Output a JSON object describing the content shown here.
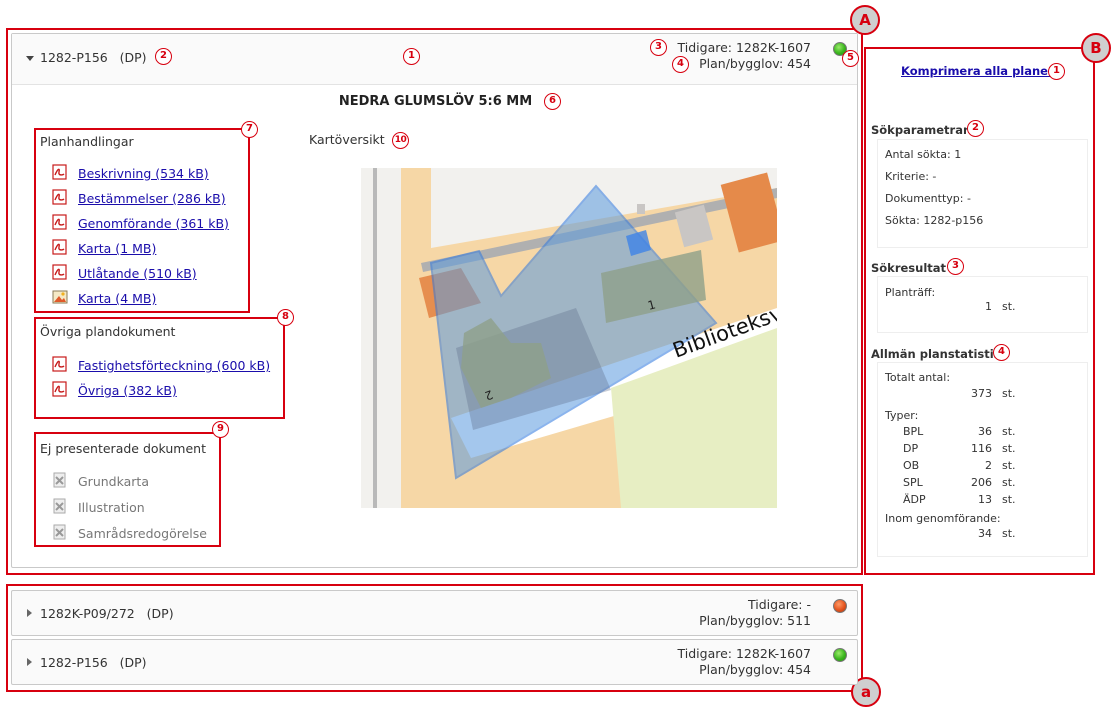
{
  "plan_main": {
    "code": "1282-P156",
    "type": "(DP)",
    "tidigare": "Tidigare: 1282K-1607",
    "plan_bygglov": "Plan/bygglov: 454",
    "status_color": "#39b51d",
    "title": "NEDRA GLUMSLÖV 5:6 MM",
    "karta_label": "Kartöversikt",
    "map_labels": {
      "parcel_1": "1",
      "parcel_2": "2",
      "street": "Biblioteksvä"
    }
  },
  "planhandlingar": {
    "title": "Planhandlingar",
    "items": [
      {
        "label": "Beskrivning (534 kB)",
        "icon": "pdf-icon"
      },
      {
        "label": "Bestämmelser (286 kB)",
        "icon": "pdf-icon"
      },
      {
        "label": "Genomförande (361 kB)",
        "icon": "pdf-icon"
      },
      {
        "label": "Karta (1 MB)",
        "icon": "pdf-icon"
      },
      {
        "label": "Utlåtande (510 kB)",
        "icon": "pdf-icon"
      },
      {
        "label": "Karta (4 MB)",
        "icon": "image-icon"
      }
    ]
  },
  "ovriga": {
    "title": "Övriga plandokument",
    "items": [
      {
        "label": "Fastighetsförteckning (600 kB)",
        "icon": "pdf-icon"
      },
      {
        "label": "Övriga (382 kB)",
        "icon": "pdf-icon"
      }
    ]
  },
  "ej_presenterade": {
    "title": "Ej presenterade dokument",
    "items": [
      {
        "label": "Grundkarta",
        "icon": "missing-document-icon"
      },
      {
        "label": "Illustration",
        "icon": "missing-document-icon"
      },
      {
        "label": "Samrådsredogörelse",
        "icon": "missing-document-icon"
      }
    ]
  },
  "plan_list": [
    {
      "code": "1282K-P09/272",
      "type": "(DP)",
      "tidigare": "Tidigare: -",
      "plan_bygglov": "Plan/bygglov: 511",
      "status_color": "#e4541f"
    },
    {
      "code": "1282-P156",
      "type": "(DP)",
      "tidigare": "Tidigare: 1282K-1607",
      "plan_bygglov": "Plan/bygglov: 454",
      "status_color": "#39b51d"
    }
  ],
  "sidebar": {
    "compress_link": "Komprimera alla planer",
    "sokparametrar": {
      "title": "Sökparametrar",
      "lines": [
        "Antal sökta: 1",
        "Kriterie: -",
        "Dokumenttyp: -",
        "Sökta: 1282-p156"
      ]
    },
    "sokresultat": {
      "title": "Sökresultat",
      "label": "Planträff:",
      "value": "1",
      "unit": "st."
    },
    "statistik": {
      "title": "Allmän planstatistik",
      "totalt_label": "Totalt antal:",
      "totalt_value": "373",
      "totalt_unit": "st.",
      "typer_label": "Typer:",
      "typer": [
        {
          "name": "BPL",
          "value": "36",
          "unit": "st."
        },
        {
          "name": "DP",
          "value": "116",
          "unit": "st."
        },
        {
          "name": "OB",
          "value": "2",
          "unit": "st."
        },
        {
          "name": "SPL",
          "value": "206",
          "unit": "st."
        },
        {
          "name": "ÄDP",
          "value": "13",
          "unit": "st."
        }
      ],
      "genomforande_label": "Inom genomförande:",
      "genomforande_value": "34",
      "genomforande_unit": "st."
    }
  },
  "annotations": {
    "region_A": "A",
    "region_B": "B",
    "region_a": "a",
    "main": [
      "1",
      "2",
      "3",
      "4",
      "5",
      "6",
      "7",
      "8",
      "9",
      "10"
    ],
    "side": [
      "1",
      "2",
      "3",
      "4"
    ]
  }
}
